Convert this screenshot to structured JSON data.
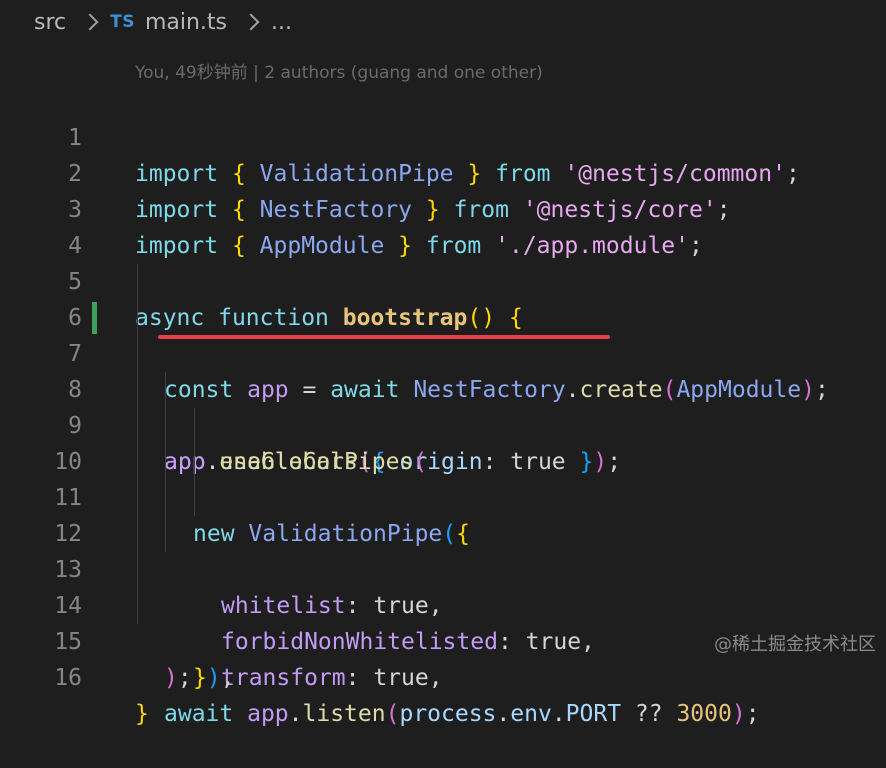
{
  "breadcrumb": {
    "folder": "src",
    "file_icon": "TS",
    "file": "main.ts",
    "ellipsis": "..."
  },
  "blame": "You, 49秒钟前 | 2 authors (guang and one other)",
  "lines": [
    {
      "n": "1",
      "t": [
        "import",
        " ",
        "{",
        " ",
        "ValidationPipe",
        " ",
        "}",
        " ",
        "from",
        " ",
        "'@nestjs/common'",
        ";"
      ]
    },
    {
      "n": "2",
      "t": [
        "import",
        " ",
        "{",
        " ",
        "NestFactory",
        " ",
        "}",
        " ",
        "from",
        " ",
        "'@nestjs/core'",
        ";"
      ]
    },
    {
      "n": "3",
      "t": [
        "import",
        " ",
        "{",
        " ",
        "AppModule",
        " ",
        "}",
        " ",
        "from",
        " ",
        "'./app.module'",
        ";"
      ]
    },
    {
      "n": "4",
      "t": []
    },
    {
      "n": "5",
      "t": [
        "async",
        " ",
        "function",
        " ",
        "bootstrap",
        "(",
        ")",
        " ",
        "{"
      ]
    },
    {
      "n": "6",
      "t": [
        "const",
        " ",
        "app",
        " = ",
        "await",
        " ",
        "NestFactory",
        ".",
        "create",
        "(",
        "AppModule",
        ")",
        ";"
      ]
    },
    {
      "n": "7",
      "t": [
        "app",
        ".",
        "enableCors",
        "(",
        "{",
        " ",
        "origin",
        ": ",
        "true",
        " ",
        "}",
        ")",
        ";"
      ]
    },
    {
      "n": "8",
      "t": [
        "app",
        ".",
        "useGlobalPipes",
        "("
      ]
    },
    {
      "n": "9",
      "t": [
        "new",
        " ",
        "ValidationPipe",
        "(",
        "{"
      ]
    },
    {
      "n": "10",
      "t": [
        "whitelist",
        ": ",
        "true",
        ","
      ]
    },
    {
      "n": "11",
      "t": [
        "forbidNonWhitelisted",
        ": ",
        "true",
        ","
      ]
    },
    {
      "n": "12",
      "t": [
        "transform",
        ": ",
        "true",
        ","
      ]
    },
    {
      "n": "13",
      "t": [
        "}",
        ")",
        ","
      ]
    },
    {
      "n": "14",
      "t": [
        ")",
        ";"
      ]
    },
    {
      "n": "15",
      "t": [
        "await",
        " ",
        "app",
        ".",
        "listen",
        "(",
        "process",
        ".",
        "env",
        ".",
        "PORT",
        " ?? ",
        "3000",
        ")",
        ";"
      ]
    },
    {
      "n": "16",
      "t": [
        "}"
      ]
    }
  ],
  "watermark": "@稀土掘金技术社区",
  "colors": {
    "background": "#1e1e1e",
    "git_added": "#3ca05a",
    "underline": "#e8404a"
  }
}
